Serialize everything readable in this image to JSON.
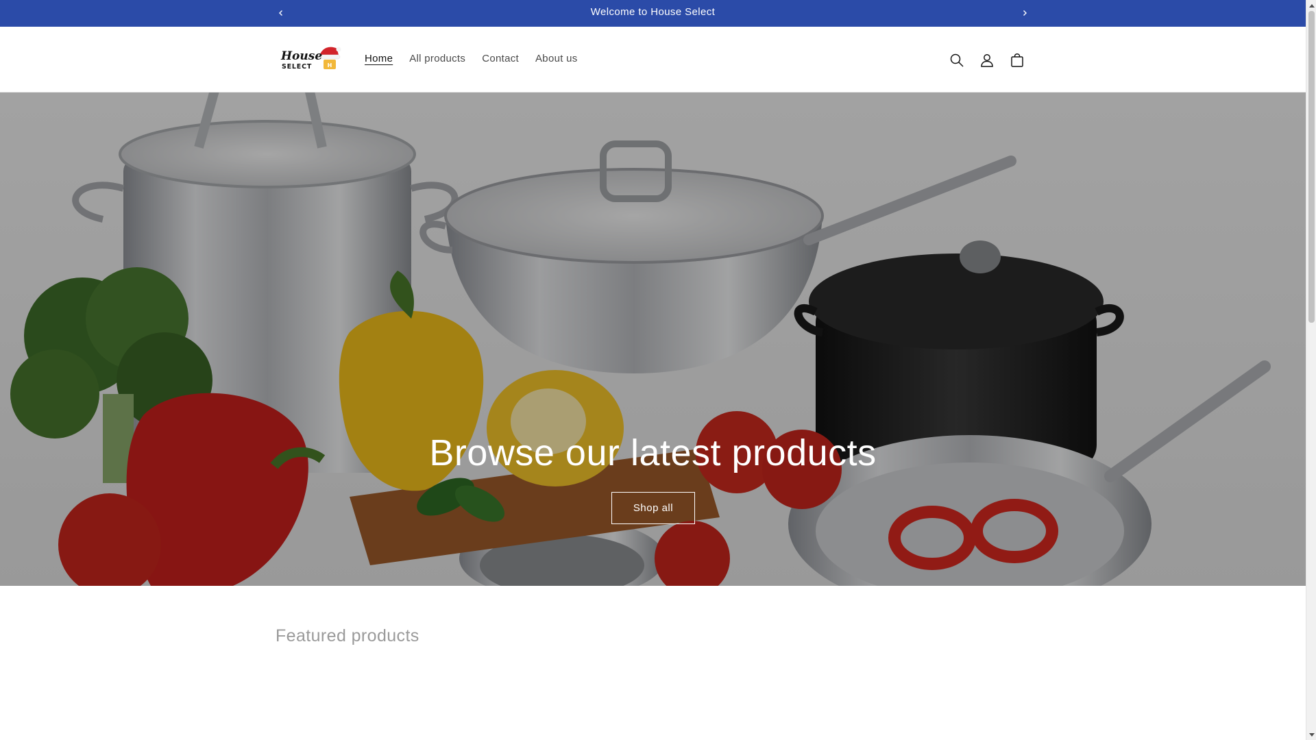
{
  "announcement": {
    "text": "Welcome to House Select",
    "prev_icon": "chevron-left-icon",
    "next_icon": "chevron-right-icon"
  },
  "header": {
    "logo_text_top": "House",
    "logo_text_bottom": "SELECT",
    "nav": [
      {
        "label": "Home",
        "active": true
      },
      {
        "label": "All products",
        "active": false
      },
      {
        "label": "Contact",
        "active": false
      },
      {
        "label": "About us",
        "active": false
      }
    ],
    "icons": [
      "search-icon",
      "account-icon",
      "cart-icon"
    ]
  },
  "hero": {
    "title": "Browse our latest products",
    "button_label": "Shop all"
  },
  "featured": {
    "title": "Featured products"
  },
  "colors": {
    "announcement_bg": "#2b4ba8",
    "text": "#121212"
  }
}
